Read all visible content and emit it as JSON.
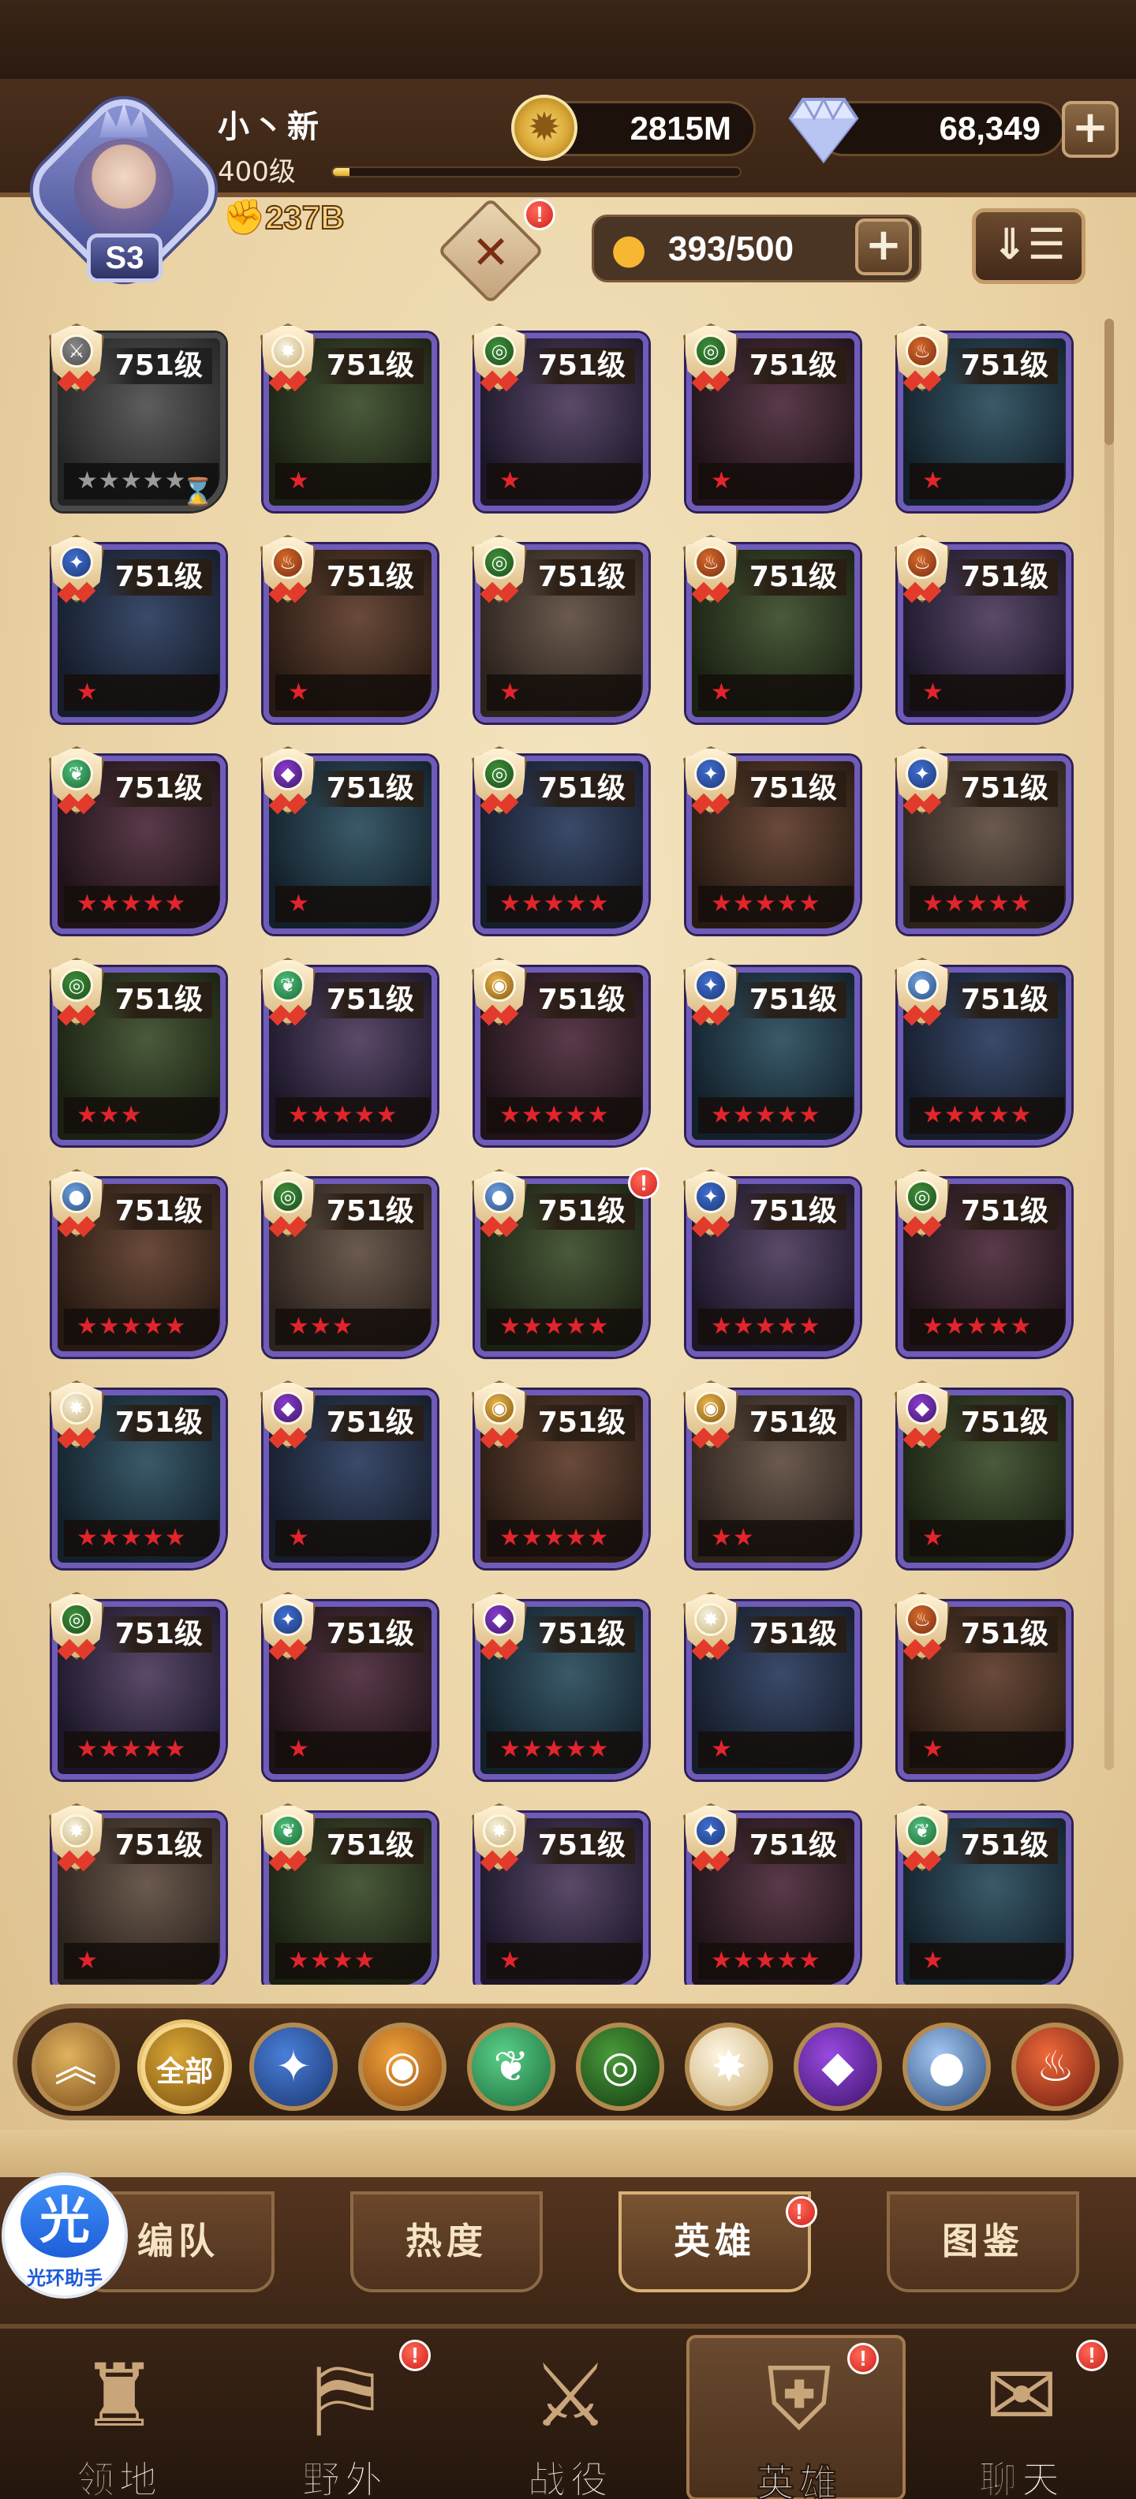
{
  "player": {
    "name": "小丶新",
    "level": "400级",
    "power": "237B",
    "badge": "S3",
    "xp_progress": 0.04
  },
  "resources": {
    "gold": "2815M",
    "diamonds": "68,349",
    "plus": "+"
  },
  "roster": {
    "count": "393/500",
    "plus": "+"
  },
  "sort_button": "⇓☰",
  "badge_alert": "!",
  "heroes": [
    {
      "level": "751级",
      "stars": "★★★★★",
      "faction": "grey",
      "locked": true
    },
    {
      "level": "751级",
      "stars": "★",
      "faction": "celestial"
    },
    {
      "level": "751级",
      "stars": "★",
      "faction": "wilder"
    },
    {
      "level": "751级",
      "stars": "★",
      "faction": "wilder"
    },
    {
      "level": "751级",
      "stars": "★",
      "faction": "mauler"
    },
    {
      "level": "751级",
      "stars": "★",
      "faction": "lightbearer"
    },
    {
      "level": "751级",
      "stars": "★",
      "faction": "mauler"
    },
    {
      "level": "751级",
      "stars": "★",
      "faction": "wilder"
    },
    {
      "level": "751级",
      "stars": "★",
      "faction": "mauler"
    },
    {
      "level": "751级",
      "stars": "★",
      "faction": "mauler"
    },
    {
      "level": "751级",
      "stars": "★★★★★",
      "faction": "green"
    },
    {
      "level": "751级",
      "stars": "★",
      "faction": "graveborn"
    },
    {
      "level": "751级",
      "stars": "★★★★★",
      "faction": "wilder"
    },
    {
      "level": "751级",
      "stars": "★★★★★",
      "faction": "lightbearer"
    },
    {
      "level": "751级",
      "stars": "★★★★★",
      "faction": "lightbearer"
    },
    {
      "level": "751级",
      "stars": "★★★",
      "faction": "wilder"
    },
    {
      "level": "751级",
      "stars": "★★★★★",
      "faction": "green"
    },
    {
      "level": "751级",
      "stars": "★★★★★",
      "faction": "gold"
    },
    {
      "level": "751级",
      "stars": "★★★★★",
      "faction": "lightbearer"
    },
    {
      "level": "751级",
      "stars": "★★★★★",
      "faction": "blue"
    },
    {
      "level": "751级",
      "stars": "★★★★★",
      "faction": "blue"
    },
    {
      "level": "751级",
      "stars": "★★★",
      "faction": "wilder"
    },
    {
      "level": "751级",
      "stars": "★★★★★",
      "faction": "blue",
      "alert": true
    },
    {
      "level": "751级",
      "stars": "★★★★★",
      "faction": "lightbearer"
    },
    {
      "level": "751级",
      "stars": "★★★★★",
      "faction": "wilder"
    },
    {
      "level": "751级",
      "stars": "★★★★★",
      "faction": "celestial"
    },
    {
      "level": "751级",
      "stars": "★",
      "faction": "graveborn"
    },
    {
      "level": "751级",
      "stars": "★★★★★",
      "faction": "gold"
    },
    {
      "level": "751级",
      "stars": "★★",
      "faction": "gold"
    },
    {
      "level": "751级",
      "stars": "★",
      "faction": "graveborn"
    },
    {
      "level": "751级",
      "stars": "★★★★★",
      "faction": "wilder"
    },
    {
      "level": "751级",
      "stars": "★",
      "faction": "lightbearer"
    },
    {
      "level": "751级",
      "stars": "★★★★★",
      "faction": "graveborn"
    },
    {
      "level": "751级",
      "stars": "★",
      "faction": "celestial"
    },
    {
      "level": "751级",
      "stars": "★",
      "faction": "mauler"
    },
    {
      "level": "751级",
      "stars": "★",
      "faction": "celestial"
    },
    {
      "level": "751级",
      "stars": "★★★★",
      "faction": "green"
    },
    {
      "level": "751级",
      "stars": "★",
      "faction": "celestial"
    },
    {
      "level": "751级",
      "stars": "★★★★★",
      "faction": "lightbearer"
    },
    {
      "level": "751级",
      "stars": "★",
      "faction": "green"
    }
  ],
  "filters": [
    {
      "label": "",
      "icon": "︽",
      "name": "collapse"
    },
    {
      "label": "全部",
      "icon": "",
      "name": "all",
      "selected": true
    },
    {
      "label": "",
      "icon": "✦",
      "name": "lightbearer"
    },
    {
      "label": "",
      "icon": "◉",
      "name": "mauler"
    },
    {
      "label": "",
      "icon": "❦",
      "name": "wilder-leaf"
    },
    {
      "label": "",
      "icon": "◎",
      "name": "wilder-eye"
    },
    {
      "label": "",
      "icon": "✸",
      "name": "celestial"
    },
    {
      "label": "",
      "icon": "◆",
      "name": "graveborn"
    },
    {
      "label": "",
      "icon": "●",
      "name": "dimensional"
    },
    {
      "label": "",
      "icon": "♨",
      "name": "hypogean"
    }
  ],
  "subtabs": [
    {
      "label": "编队",
      "name": "formation"
    },
    {
      "label": "热度",
      "name": "popularity"
    },
    {
      "label": "英雄",
      "name": "heroes",
      "active": true,
      "alert": true
    },
    {
      "label": "图鉴",
      "name": "codex"
    }
  ],
  "nav": [
    {
      "label": "领地",
      "icon": "♜",
      "name": "territory"
    },
    {
      "label": "野外",
      "icon": "⛿",
      "name": "wild",
      "alert": true
    },
    {
      "label": "战役",
      "icon": "⚔",
      "name": "campaign"
    },
    {
      "label": "英雄",
      "icon": "⛨",
      "name": "heroes",
      "active": true,
      "alert": true
    },
    {
      "label": "聊天",
      "icon": "✉",
      "name": "chat",
      "alert": true
    }
  ],
  "helper": {
    "glyph": "光",
    "caption": "光环助手"
  },
  "colors": {
    "panel": "#ead3a5",
    "frame_purple": "#6f5bb8",
    "star_red": "#e2242c",
    "alert_red": "#d0201a"
  }
}
